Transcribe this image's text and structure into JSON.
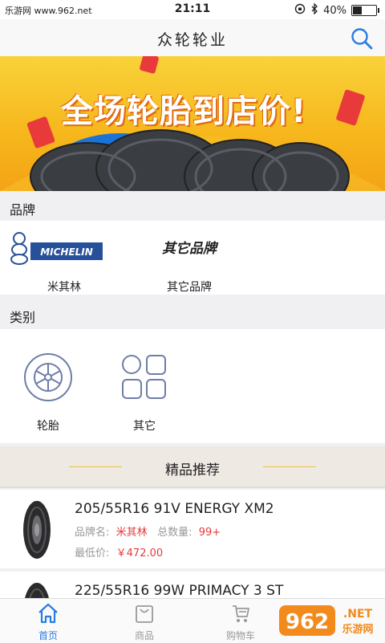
{
  "status": {
    "site": "乐游网 www.962.net",
    "time": "21:11",
    "battery": "40%",
    "battery_level": 0.4
  },
  "header": {
    "title": "众轮轮业"
  },
  "banner": {
    "headline": "全场轮胎到店价!",
    "slides": 2,
    "active_slide": 0
  },
  "brand_section": {
    "title": "品牌",
    "items": [
      {
        "label": "米其林",
        "logo_text": "MICHELIN"
      },
      {
        "label": "其它品牌",
        "logo_text": "其它品牌"
      }
    ]
  },
  "category_section": {
    "title": "类别",
    "items": [
      {
        "label": "轮胎",
        "icon": "tyre-icon"
      },
      {
        "label": "其它",
        "icon": "grid-icon"
      }
    ]
  },
  "recommend": {
    "title": "精品推荐"
  },
  "products": [
    {
      "title": "205/55R16 91V ENERGY XM2",
      "brand_label": "品牌名:",
      "brand": "米其林",
      "qty_label": "总数量:",
      "qty": "99+",
      "price_label": "最低价:",
      "price": "￥472.00"
    },
    {
      "title": "225/55R16 99W PRIMACY 3 ST"
    }
  ],
  "tabbar": {
    "items": [
      {
        "label": "首页",
        "icon": "home-icon"
      },
      {
        "label": "商品",
        "icon": "bag-icon"
      },
      {
        "label": "购物车",
        "icon": "cart-icon"
      }
    ]
  },
  "watermark": {
    "text": "962",
    "sub": "乐游网",
    "tld": ".NET"
  },
  "colors": {
    "accent": "#2a7de1",
    "price": "#e83a3a",
    "banner": "#f6b81d",
    "michelin_blue": "#27509b"
  }
}
